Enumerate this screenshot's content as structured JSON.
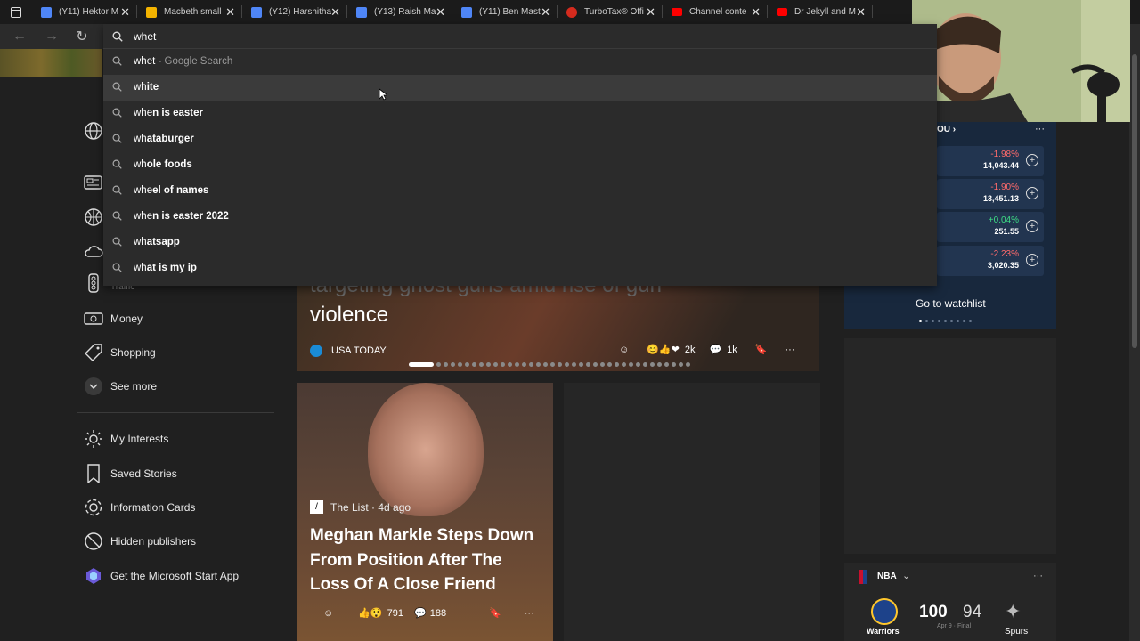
{
  "tabs": [
    {
      "title": "(Y11) Hektor M",
      "color": "#4f86f7"
    },
    {
      "title": "Macbeth small",
      "color": "#f4b400"
    },
    {
      "title": "(Y12) Harshitha",
      "color": "#4f86f7"
    },
    {
      "title": "(Y13) Raish Ma",
      "color": "#4f86f7"
    },
    {
      "title": "(Y11) Ben Mast",
      "color": "#4f86f7"
    },
    {
      "title": "TurboTax® Offi",
      "color": "#d52b1e"
    },
    {
      "title": "Channel conte",
      "color": "#ff0000"
    },
    {
      "title": "Dr Jekyll and M",
      "color": "#ff0000"
    }
  ],
  "omnibox": {
    "query": "whet",
    "suggestions": [
      {
        "typed": "whet",
        "rest": "",
        "suffix": " - Google Search"
      },
      {
        "typed": "wh",
        "rest": "ite",
        "suffix": ""
      },
      {
        "typed": "whe",
        "rest": "n is easter",
        "suffix": ""
      },
      {
        "typed": "wh",
        "rest": "ataburger",
        "suffix": ""
      },
      {
        "typed": "wh",
        "rest": "ole foods",
        "suffix": ""
      },
      {
        "typed": "whe",
        "rest": "el of names",
        "suffix": ""
      },
      {
        "typed": "whe",
        "rest": "n is easter 2022",
        "suffix": ""
      },
      {
        "typed": "wh",
        "rest": "atsapp",
        "suffix": ""
      },
      {
        "typed": "wh",
        "rest": "at is my ip",
        "suffix": ""
      }
    ]
  },
  "sidebar": {
    "items": [
      {
        "label": "Traffic"
      },
      {
        "label": "Money"
      },
      {
        "label": "Shopping"
      },
      {
        "label": "See more"
      },
      {
        "label": "My Interests"
      },
      {
        "label": "Saved Stories"
      },
      {
        "label": "Information Cards"
      },
      {
        "label": "Hidden publishers"
      },
      {
        "label": "Get the Microsoft Start App"
      }
    ]
  },
  "hero": {
    "title_partial": "targeting ghost guns amid rise of gun",
    "title_line2": "violence",
    "source": "USA TODAY",
    "reactions": "2k",
    "comments": "1k"
  },
  "card2": {
    "source": "The List · 4d ago",
    "title": "Meghan Markle Steps Down From Position After The Loss Of A Close Friend",
    "reactions": "791",
    "comments": "188"
  },
  "watchlist": {
    "header_partial": "OU",
    "items": [
      {
        "change": "-1.98%",
        "value": "14,043.44",
        "color": "#ff6b6b"
      },
      {
        "change": "-1.90%",
        "value": "13,451.13",
        "color": "#ff6b6b"
      },
      {
        "change": "+0.04%",
        "value": "251.55",
        "color": "#3ddc84"
      },
      {
        "change": "-2.23%",
        "value": "3,020.35",
        "color": "#ff6b6b"
      }
    ],
    "link": "Go to watchlist"
  },
  "nba": {
    "league": "NBA",
    "home_team": "Warriors",
    "away_team": "Spurs",
    "home_score": "100",
    "away_score": "94",
    "status": "Apr 9 · Final"
  }
}
